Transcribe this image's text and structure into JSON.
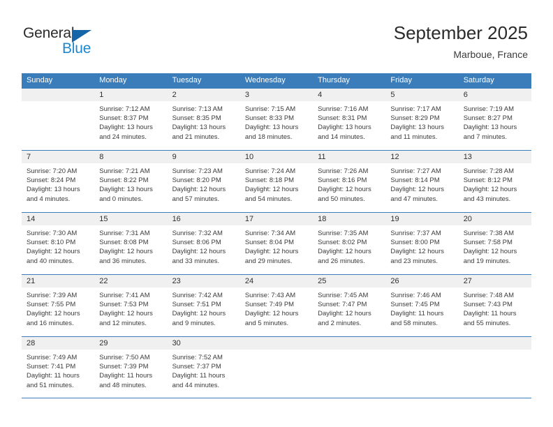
{
  "brand": {
    "name_part1": "General",
    "name_part2": "Blue",
    "accent_color": "#1f86d0",
    "triangle_color": "#1565a8"
  },
  "header": {
    "title": "September 2025",
    "location": "Marboue, France"
  },
  "calendar": {
    "header_color": "#3a7dba",
    "weekdays": [
      "Sunday",
      "Monday",
      "Tuesday",
      "Wednesday",
      "Thursday",
      "Friday",
      "Saturday"
    ],
    "weeks": [
      [
        {
          "day": "",
          "sunrise": "",
          "sunset": "",
          "daylight_line1": "",
          "daylight_line2": ""
        },
        {
          "day": "1",
          "sunrise": "Sunrise: 7:12 AM",
          "sunset": "Sunset: 8:37 PM",
          "daylight_line1": "Daylight: 13 hours",
          "daylight_line2": "and 24 minutes."
        },
        {
          "day": "2",
          "sunrise": "Sunrise: 7:13 AM",
          "sunset": "Sunset: 8:35 PM",
          "daylight_line1": "Daylight: 13 hours",
          "daylight_line2": "and 21 minutes."
        },
        {
          "day": "3",
          "sunrise": "Sunrise: 7:15 AM",
          "sunset": "Sunset: 8:33 PM",
          "daylight_line1": "Daylight: 13 hours",
          "daylight_line2": "and 18 minutes."
        },
        {
          "day": "4",
          "sunrise": "Sunrise: 7:16 AM",
          "sunset": "Sunset: 8:31 PM",
          "daylight_line1": "Daylight: 13 hours",
          "daylight_line2": "and 14 minutes."
        },
        {
          "day": "5",
          "sunrise": "Sunrise: 7:17 AM",
          "sunset": "Sunset: 8:29 PM",
          "daylight_line1": "Daylight: 13 hours",
          "daylight_line2": "and 11 minutes."
        },
        {
          "day": "6",
          "sunrise": "Sunrise: 7:19 AM",
          "sunset": "Sunset: 8:27 PM",
          "daylight_line1": "Daylight: 13 hours",
          "daylight_line2": "and 7 minutes."
        }
      ],
      [
        {
          "day": "7",
          "sunrise": "Sunrise: 7:20 AM",
          "sunset": "Sunset: 8:24 PM",
          "daylight_line1": "Daylight: 13 hours",
          "daylight_line2": "and 4 minutes."
        },
        {
          "day": "8",
          "sunrise": "Sunrise: 7:21 AM",
          "sunset": "Sunset: 8:22 PM",
          "daylight_line1": "Daylight: 13 hours",
          "daylight_line2": "and 0 minutes."
        },
        {
          "day": "9",
          "sunrise": "Sunrise: 7:23 AM",
          "sunset": "Sunset: 8:20 PM",
          "daylight_line1": "Daylight: 12 hours",
          "daylight_line2": "and 57 minutes."
        },
        {
          "day": "10",
          "sunrise": "Sunrise: 7:24 AM",
          "sunset": "Sunset: 8:18 PM",
          "daylight_line1": "Daylight: 12 hours",
          "daylight_line2": "and 54 minutes."
        },
        {
          "day": "11",
          "sunrise": "Sunrise: 7:26 AM",
          "sunset": "Sunset: 8:16 PM",
          "daylight_line1": "Daylight: 12 hours",
          "daylight_line2": "and 50 minutes."
        },
        {
          "day": "12",
          "sunrise": "Sunrise: 7:27 AM",
          "sunset": "Sunset: 8:14 PM",
          "daylight_line1": "Daylight: 12 hours",
          "daylight_line2": "and 47 minutes."
        },
        {
          "day": "13",
          "sunrise": "Sunrise: 7:28 AM",
          "sunset": "Sunset: 8:12 PM",
          "daylight_line1": "Daylight: 12 hours",
          "daylight_line2": "and 43 minutes."
        }
      ],
      [
        {
          "day": "14",
          "sunrise": "Sunrise: 7:30 AM",
          "sunset": "Sunset: 8:10 PM",
          "daylight_line1": "Daylight: 12 hours",
          "daylight_line2": "and 40 minutes."
        },
        {
          "day": "15",
          "sunrise": "Sunrise: 7:31 AM",
          "sunset": "Sunset: 8:08 PM",
          "daylight_line1": "Daylight: 12 hours",
          "daylight_line2": "and 36 minutes."
        },
        {
          "day": "16",
          "sunrise": "Sunrise: 7:32 AM",
          "sunset": "Sunset: 8:06 PM",
          "daylight_line1": "Daylight: 12 hours",
          "daylight_line2": "and 33 minutes."
        },
        {
          "day": "17",
          "sunrise": "Sunrise: 7:34 AM",
          "sunset": "Sunset: 8:04 PM",
          "daylight_line1": "Daylight: 12 hours",
          "daylight_line2": "and 29 minutes."
        },
        {
          "day": "18",
          "sunrise": "Sunrise: 7:35 AM",
          "sunset": "Sunset: 8:02 PM",
          "daylight_line1": "Daylight: 12 hours",
          "daylight_line2": "and 26 minutes."
        },
        {
          "day": "19",
          "sunrise": "Sunrise: 7:37 AM",
          "sunset": "Sunset: 8:00 PM",
          "daylight_line1": "Daylight: 12 hours",
          "daylight_line2": "and 23 minutes."
        },
        {
          "day": "20",
          "sunrise": "Sunrise: 7:38 AM",
          "sunset": "Sunset: 7:58 PM",
          "daylight_line1": "Daylight: 12 hours",
          "daylight_line2": "and 19 minutes."
        }
      ],
      [
        {
          "day": "21",
          "sunrise": "Sunrise: 7:39 AM",
          "sunset": "Sunset: 7:55 PM",
          "daylight_line1": "Daylight: 12 hours",
          "daylight_line2": "and 16 minutes."
        },
        {
          "day": "22",
          "sunrise": "Sunrise: 7:41 AM",
          "sunset": "Sunset: 7:53 PM",
          "daylight_line1": "Daylight: 12 hours",
          "daylight_line2": "and 12 minutes."
        },
        {
          "day": "23",
          "sunrise": "Sunrise: 7:42 AM",
          "sunset": "Sunset: 7:51 PM",
          "daylight_line1": "Daylight: 12 hours",
          "daylight_line2": "and 9 minutes."
        },
        {
          "day": "24",
          "sunrise": "Sunrise: 7:43 AM",
          "sunset": "Sunset: 7:49 PM",
          "daylight_line1": "Daylight: 12 hours",
          "daylight_line2": "and 5 minutes."
        },
        {
          "day": "25",
          "sunrise": "Sunrise: 7:45 AM",
          "sunset": "Sunset: 7:47 PM",
          "daylight_line1": "Daylight: 12 hours",
          "daylight_line2": "and 2 minutes."
        },
        {
          "day": "26",
          "sunrise": "Sunrise: 7:46 AM",
          "sunset": "Sunset: 7:45 PM",
          "daylight_line1": "Daylight: 11 hours",
          "daylight_line2": "and 58 minutes."
        },
        {
          "day": "27",
          "sunrise": "Sunrise: 7:48 AM",
          "sunset": "Sunset: 7:43 PM",
          "daylight_line1": "Daylight: 11 hours",
          "daylight_line2": "and 55 minutes."
        }
      ],
      [
        {
          "day": "28",
          "sunrise": "Sunrise: 7:49 AM",
          "sunset": "Sunset: 7:41 PM",
          "daylight_line1": "Daylight: 11 hours",
          "daylight_line2": "and 51 minutes."
        },
        {
          "day": "29",
          "sunrise": "Sunrise: 7:50 AM",
          "sunset": "Sunset: 7:39 PM",
          "daylight_line1": "Daylight: 11 hours",
          "daylight_line2": "and 48 minutes."
        },
        {
          "day": "30",
          "sunrise": "Sunrise: 7:52 AM",
          "sunset": "Sunset: 7:37 PM",
          "daylight_line1": "Daylight: 11 hours",
          "daylight_line2": "and 44 minutes."
        },
        {
          "day": "",
          "sunrise": "",
          "sunset": "",
          "daylight_line1": "",
          "daylight_line2": ""
        },
        {
          "day": "",
          "sunrise": "",
          "sunset": "",
          "daylight_line1": "",
          "daylight_line2": ""
        },
        {
          "day": "",
          "sunrise": "",
          "sunset": "",
          "daylight_line1": "",
          "daylight_line2": ""
        },
        {
          "day": "",
          "sunrise": "",
          "sunset": "",
          "daylight_line1": "",
          "daylight_line2": ""
        }
      ]
    ]
  }
}
